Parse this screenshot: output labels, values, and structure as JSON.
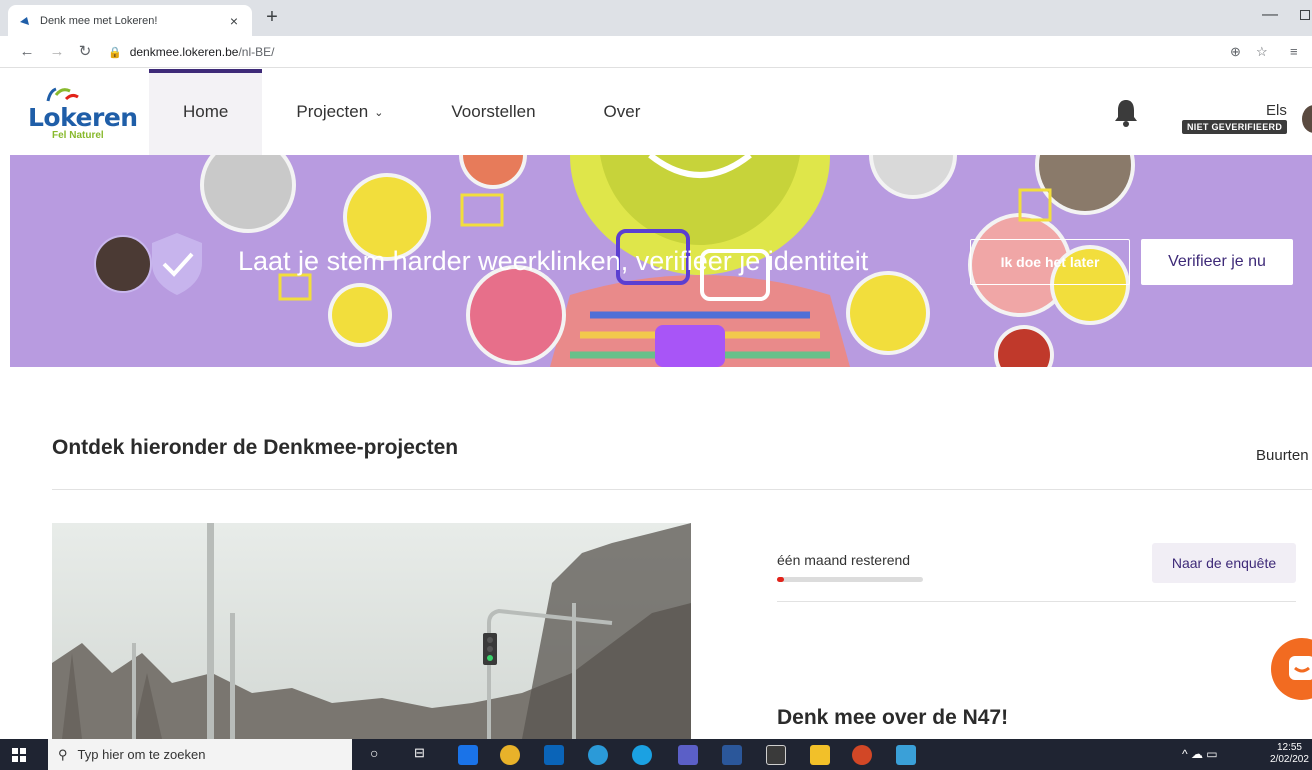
{
  "browser": {
    "tab_title": "Denk mee met Lokeren!",
    "tab_close": "×",
    "new_tab": "+",
    "url_host": "denkmee.lokeren.be",
    "url_path": "/nl-BE/"
  },
  "header": {
    "logo_word": "Lokeren",
    "logo_sub": "Fel Naturel",
    "nav": [
      {
        "label": "Home"
      },
      {
        "label": "Projecten"
      },
      {
        "label": "Voorstellen"
      },
      {
        "label": "Over"
      }
    ],
    "user_name": "Els",
    "verification_badge": "NIET GEVERIFIEERD"
  },
  "hero": {
    "message": "Laat je stem harder weerklinken, verifieer je identiteit",
    "later_button": "Ik doe het later",
    "verify_button": "Verifieer je nu"
  },
  "content": {
    "section_title": "Ontdek hieronder de Denkmee-projecten",
    "section_right": "Buurten",
    "card": {
      "remaining": "één maand resterend",
      "progress": 0.05,
      "survey_button": "Naar de enquête",
      "title": "Denk mee over de N47!"
    }
  },
  "taskbar": {
    "search_placeholder": "Typ hier om te zoeken",
    "time": "12:55",
    "date": "2/02/202"
  },
  "colors": {
    "brand_purple": "#3e2a78",
    "hero_bg": "#b89be0",
    "progress_red": "#e2231a",
    "chat_orange": "#f26b21"
  }
}
